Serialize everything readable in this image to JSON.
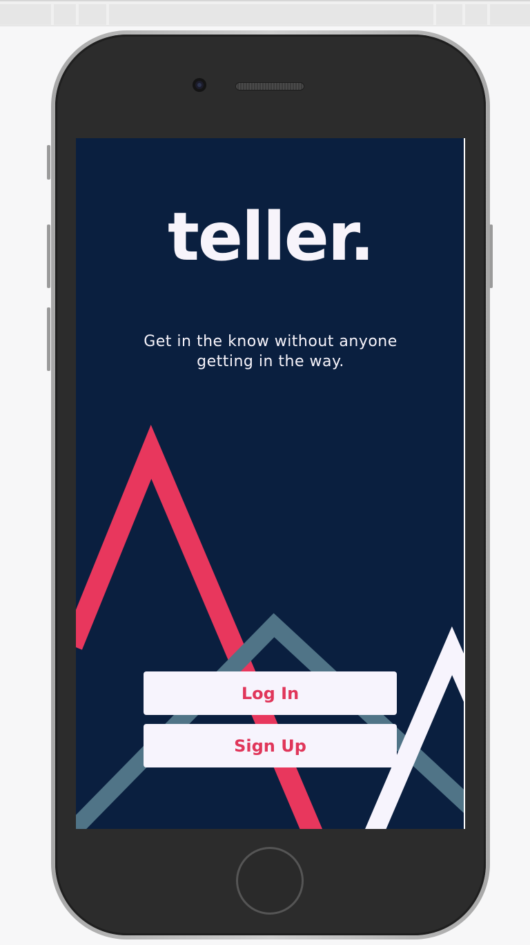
{
  "app": {
    "logo_text": "teller.",
    "tagline": "Get in the know without anyone getting in the way."
  },
  "actions": {
    "login_label": "Log In",
    "signup_label": "Sign Up"
  },
  "colors": {
    "background": "#0a1f3f",
    "accent_red": "#e8375d",
    "accent_teal": "#507487",
    "accent_white": "#f7f4fd",
    "button_text": "#e0365a"
  }
}
